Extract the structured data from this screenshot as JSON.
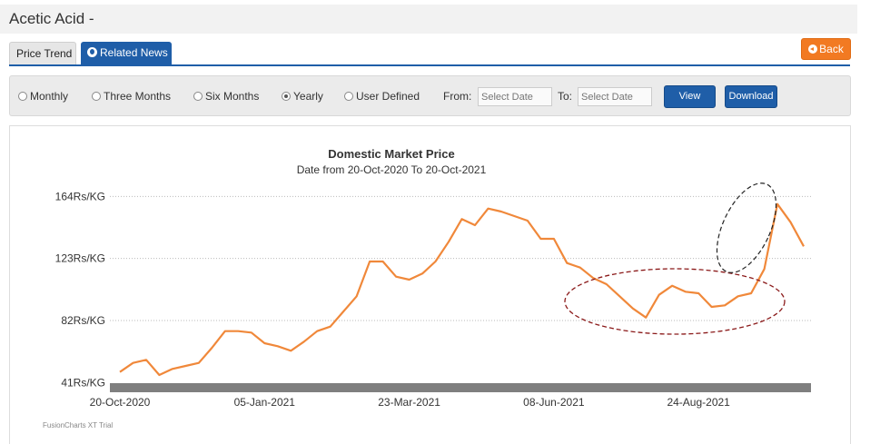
{
  "page": {
    "title": "Acetic Acid -"
  },
  "tabs": [
    {
      "label": "Price Trend"
    },
    {
      "label": "Related News"
    }
  ],
  "back_button": {
    "label": "Back"
  },
  "filters": {
    "options": [
      {
        "label": "Monthly",
        "checked": false
      },
      {
        "label": "Three Months",
        "checked": false
      },
      {
        "label": "Six Months",
        "checked": false
      },
      {
        "label": "Yearly",
        "checked": true
      },
      {
        "label": "User Defined",
        "checked": false
      }
    ],
    "from_label": "From:",
    "to_label": "To:",
    "from_placeholder": "Select Date",
    "to_placeholder": "Select Date",
    "view_label": "View",
    "download_label": "Download"
  },
  "chart_data": {
    "type": "line",
    "title": "Domestic Market Price",
    "subtitle": "Date from 20-Oct-2020 To 20-Oct-2021",
    "y_ticks": [
      {
        "value": 41,
        "label": "41Rs/KG"
      },
      {
        "value": 82,
        "label": "82Rs/KG"
      },
      {
        "value": 123,
        "label": "123Rs/KG"
      },
      {
        "value": 164,
        "label": "164Rs/KG"
      }
    ],
    "x_ticks": [
      "20-Oct-2020",
      "05-Jan-2021",
      "23-Mar-2021",
      "08-Jun-2021",
      "24-Aug-2021"
    ],
    "ylim": [
      40,
      166
    ],
    "grid": true,
    "color": "#f0883a",
    "watermark": "FusionCharts XT Trial",
    "series": [
      {
        "values": [
          48,
          54,
          56,
          46,
          50,
          52,
          54,
          64,
          75,
          75,
          74,
          67,
          65,
          62,
          68,
          75,
          78,
          88,
          98,
          121,
          121,
          111,
          109,
          113,
          121,
          134,
          149,
          145,
          156,
          154,
          151,
          148,
          136,
          136,
          120,
          117,
          110,
          106,
          98,
          90,
          84,
          99,
          105,
          101,
          100,
          91,
          92,
          98,
          100,
          116,
          159,
          147,
          131
        ]
      }
    ]
  }
}
